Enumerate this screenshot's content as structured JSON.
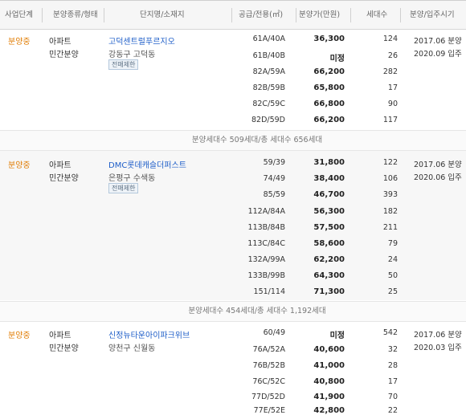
{
  "header": {
    "stage": "사업단계",
    "kind": "분양종류/형태",
    "complex": "단지명/소재지",
    "area": "공급/전용(㎡)",
    "price": "분양가(만원)",
    "units": "세대수",
    "period": "분양/입주시기"
  },
  "groups": [
    {
      "status": "분양중",
      "type": "아파트",
      "subtype": "민간분양",
      "name": "고덕센트럴푸르지오",
      "address": "강동구 고덕동",
      "tag": "전매제한",
      "sale": "2017.06 분양",
      "movein": "2020.09 입주",
      "rows": [
        {
          "area": "61A/40A",
          "price": "36,300",
          "units": "124"
        },
        {
          "area": "61B/40B",
          "price": "미정",
          "units": "26"
        },
        {
          "area": "82A/59A",
          "price": "66,200",
          "units": "282"
        },
        {
          "area": "82B/59B",
          "price": "65,800",
          "units": "17"
        },
        {
          "area": "82C/59C",
          "price": "66,800",
          "units": "90"
        },
        {
          "area": "82D/59D",
          "price": "66,200",
          "units": "117"
        }
      ],
      "summary": "분양세대수 509세대/총 세대수 656세대"
    },
    {
      "status": "분양중",
      "type": "아파트",
      "subtype": "민간분양",
      "name": "DMC롯데캐슬더퍼스트",
      "address": "은평구 수색동",
      "tag": "전매제한",
      "sale": "2017.06 분양",
      "movein": "2020.06 입주",
      "rows": [
        {
          "area": "59/39",
          "price": "31,800",
          "units": "122"
        },
        {
          "area": "74/49",
          "price": "38,400",
          "units": "106"
        },
        {
          "area": "85/59",
          "price": "46,700",
          "units": "393"
        },
        {
          "area": "112A/84A",
          "price": "56,300",
          "units": "182"
        },
        {
          "area": "113B/84B",
          "price": "57,500",
          "units": "211"
        },
        {
          "area": "113C/84C",
          "price": "58,600",
          "units": "79"
        },
        {
          "area": "132A/99A",
          "price": "62,200",
          "units": "24"
        },
        {
          "area": "133B/99B",
          "price": "64,300",
          "units": "50"
        },
        {
          "area": "151/114",
          "price": "71,300",
          "units": "25"
        }
      ],
      "summary": "분양세대수 454세대/총 세대수 1,192세대"
    },
    {
      "status": "분양중",
      "type": "아파트",
      "subtype": "민간분양",
      "name": "신정뉴타운아이파크위브",
      "address": "양천구 신월동",
      "tag": "",
      "sale": "2017.06 분양",
      "movein": "2020.03 입주",
      "rows": [
        {
          "area": "60/49",
          "price": "미정",
          "units": "542"
        },
        {
          "area": "76A/52A",
          "price": "40,600",
          "units": "32"
        },
        {
          "area": "76B/52B",
          "price": "41,000",
          "units": "28"
        },
        {
          "area": "76C/52C",
          "price": "40,800",
          "units": "17"
        },
        {
          "area": "77D/52D",
          "price": "41,900",
          "units": "70"
        },
        {
          "area": "77E/52E",
          "price": "42,800",
          "units": "22"
        }
      ],
      "summary": ""
    }
  ]
}
